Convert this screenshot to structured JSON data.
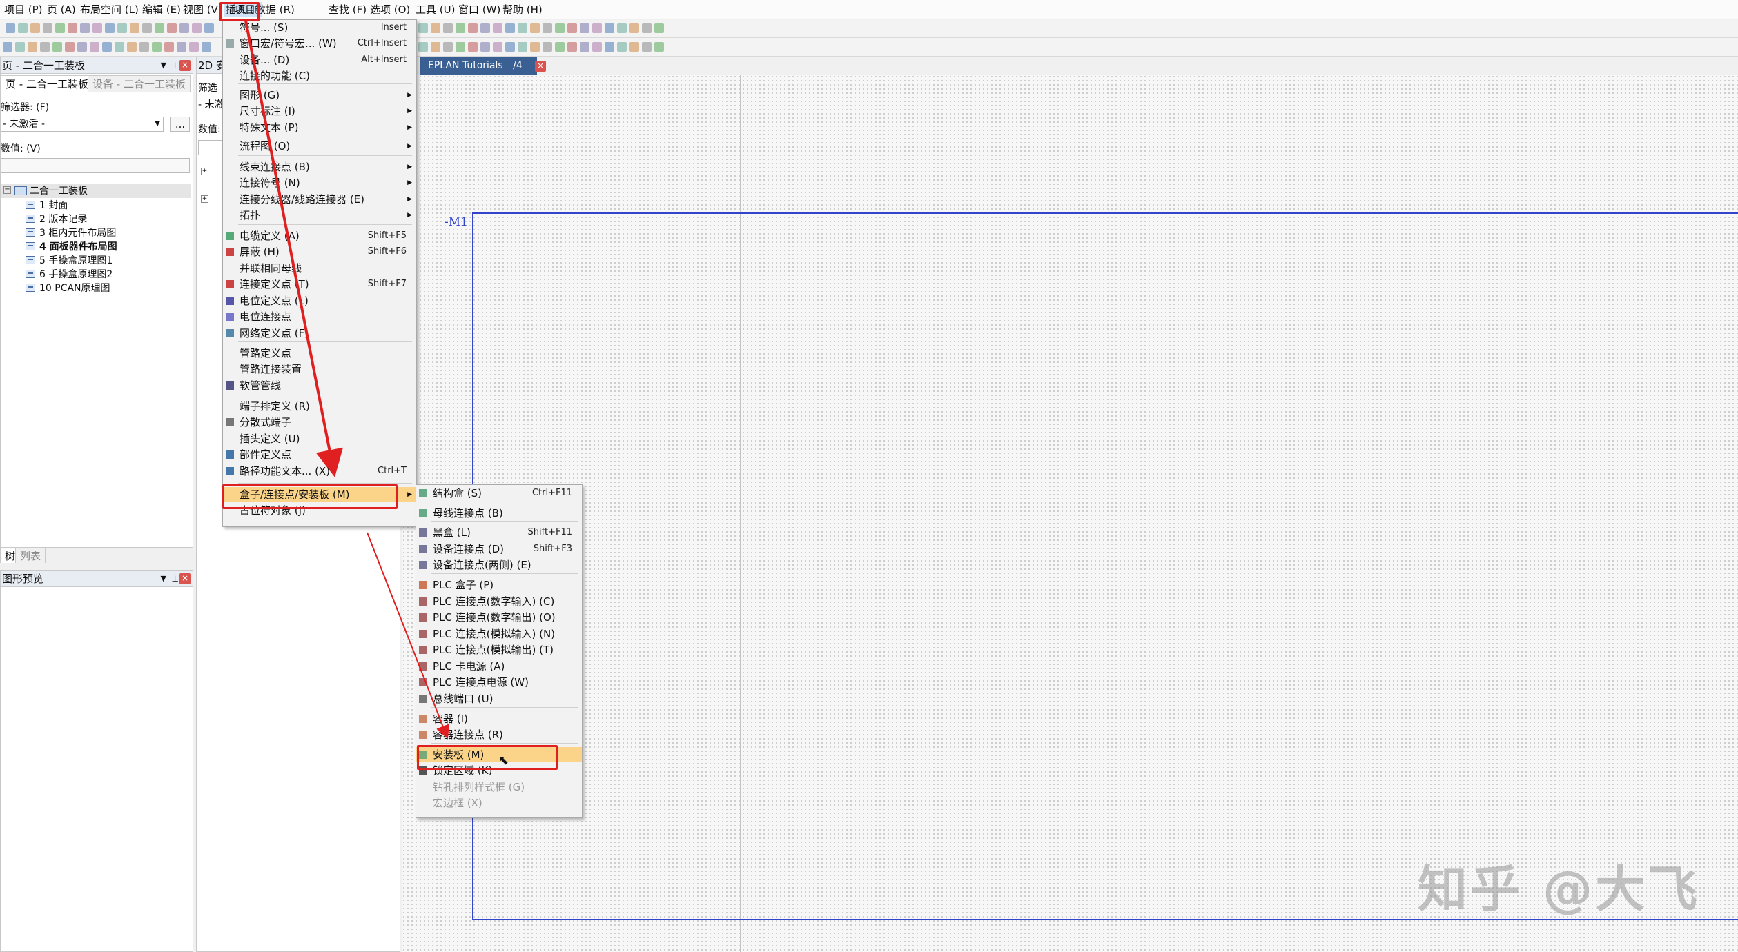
{
  "menubar": {
    "items": [
      "项目 (P)",
      "页 (A)",
      "布局空间 (L)",
      "编辑 (E)",
      "视图 (V)",
      "插入 (I)",
      "项目数据 (R)",
      "查找 (F)",
      "选项 (O)",
      "工具 (U)",
      "窗口 (W)",
      "帮助 (H)"
    ]
  },
  "left_panel": {
    "title": "页 - 二合一工装板",
    "tabs": [
      "页 - 二合一工装板",
      "设备 - 二合一工装板"
    ],
    "filter_label": "筛选器: (F)",
    "filter_value": "- 未激活 -",
    "filter_button": "...",
    "value_label": "数值: (V)",
    "tree_root": "二合一工装板",
    "tree_items": [
      "1 封面",
      "2 版本记录",
      "3 柜内元件布局图",
      "4 面板器件布局图",
      "5 手操盒原理图1",
      "6 手操盒原理图2",
      "10 PCAN原理图"
    ],
    "bottom_tabs": [
      "树",
      "列表"
    ]
  },
  "preview_panel": {
    "title": "图形预览"
  },
  "middle_panel": {
    "title": "2D 安",
    "filter_label": "筛选",
    "filter_value": "- 未激",
    "value_label": "数值:"
  },
  "doc_tab": {
    "label": "EPLAN Tutorials",
    "suffix": "/4",
    "close": "×"
  },
  "canvas": {
    "device_label": "-M1"
  },
  "insert_menu": {
    "items": [
      {
        "label": "符号... (S)",
        "shortcut": "Insert"
      },
      {
        "label": "窗口宏/符号宏... (W)",
        "shortcut": "Ctrl+Insert"
      },
      {
        "label": "设备... (D)",
        "shortcut": "Alt+Insert"
      },
      {
        "label": "连接的功能 (C)",
        "shortcut": ""
      },
      {
        "label": "图形 (G)",
        "shortcut": ""
      },
      {
        "label": "尺寸标注 (I)",
        "shortcut": ""
      },
      {
        "label": "特殊文本 (P)",
        "shortcut": ""
      },
      {
        "label": "流程图 (O)",
        "shortcut": ""
      },
      {
        "label": "线束连接点 (B)",
        "shortcut": ""
      },
      {
        "label": "连接符号 (N)",
        "shortcut": ""
      },
      {
        "label": "连接分线器/线路连接器 (E)",
        "shortcut": ""
      },
      {
        "label": "拓扑",
        "shortcut": ""
      },
      {
        "label": "电缆定义 (A)",
        "shortcut": "Shift+F5"
      },
      {
        "label": "屏蔽 (H)",
        "shortcut": "Shift+F6"
      },
      {
        "label": "并联相同母线",
        "shortcut": ""
      },
      {
        "label": "连接定义点 (T)",
        "shortcut": "Shift+F7"
      },
      {
        "label": "电位定义点 (L)",
        "shortcut": ""
      },
      {
        "label": "电位连接点",
        "shortcut": ""
      },
      {
        "label": "网络定义点 (F)",
        "shortcut": ""
      },
      {
        "label": "管路定义点",
        "shortcut": ""
      },
      {
        "label": "管路连接装置",
        "shortcut": ""
      },
      {
        "label": "软管管线",
        "shortcut": ""
      },
      {
        "label": "端子排定义 (R)",
        "shortcut": ""
      },
      {
        "label": "分散式端子",
        "shortcut": ""
      },
      {
        "label": "插头定义 (U)",
        "shortcut": ""
      },
      {
        "label": "部件定义点",
        "shortcut": ""
      },
      {
        "label": "路径功能文本... (X)",
        "shortcut": "Ctrl+T"
      },
      {
        "label": "盒子/连接点/安装板 (M)",
        "shortcut": ""
      },
      {
        "label": "占位符对象 (J)",
        "shortcut": ""
      }
    ]
  },
  "submenu": {
    "items": [
      {
        "label": "结构盒 (S)",
        "shortcut": "Ctrl+F11"
      },
      {
        "label": "母线连接点 (B)",
        "shortcut": ""
      },
      {
        "label": "黑盒 (L)",
        "shortcut": "Shift+F11"
      },
      {
        "label": "设备连接点 (D)",
        "shortcut": "Shift+F3"
      },
      {
        "label": "设备连接点(两侧) (E)",
        "shortcut": ""
      },
      {
        "label": "PLC 盒子 (P)",
        "shortcut": ""
      },
      {
        "label": "PLC 连接点(数字输入) (C)",
        "shortcut": ""
      },
      {
        "label": "PLC 连接点(数字输出) (O)",
        "shortcut": ""
      },
      {
        "label": "PLC 连接点(模拟输入) (N)",
        "shortcut": ""
      },
      {
        "label": "PLC 连接点(模拟输出) (T)",
        "shortcut": ""
      },
      {
        "label": "PLC 卡电源 (A)",
        "shortcut": ""
      },
      {
        "label": "PLC 连接点电源 (W)",
        "shortcut": ""
      },
      {
        "label": "总线端口 (U)",
        "shortcut": ""
      },
      {
        "label": "容器 (I)",
        "shortcut": ""
      },
      {
        "label": "容器连接点 (R)",
        "shortcut": ""
      },
      {
        "label": "安装板 (M)",
        "shortcut": ""
      },
      {
        "label": "锁定区域 (K)",
        "shortcut": ""
      },
      {
        "label": "钻孔排列样式框 (G)",
        "shortcut": ""
      },
      {
        "label": "宏边框 (X)",
        "shortcut": ""
      }
    ]
  },
  "watermark": "知乎 @大飞",
  "colors": {
    "highlight": "#fbd48a",
    "annotation_red": "#e02020",
    "border_blue": "#3344cc"
  }
}
